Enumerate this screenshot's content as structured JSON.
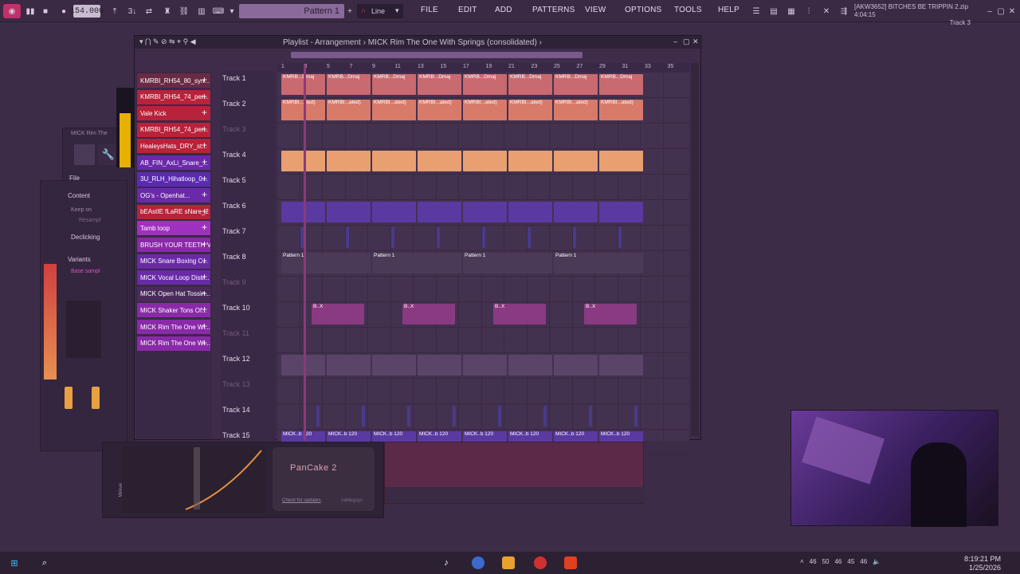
{
  "toolbar": {
    "bpm": "154.000",
    "pattern": "Pattern 1",
    "snap": "Line",
    "menus": [
      "FILE",
      "EDIT",
      "ADD",
      "PATTERNS",
      "VIEW",
      "OPTIONS",
      "TOOLS",
      "HELP"
    ],
    "hint_line1": "[AKW3652] BITCHES BE TRIPPIN 2.zip",
    "hint_line2": "4:04:15",
    "hint_line3": "Track 3"
  },
  "playlist": {
    "title": "Playlist - Arrangement › MICK Rim The One With Springs (consolidated) ›",
    "ruler": [
      "1",
      "3",
      "5",
      "7",
      "9",
      "11",
      "13",
      "15",
      "17",
      "19",
      "21",
      "23",
      "25",
      "27",
      "29",
      "31",
      "33",
      "35"
    ],
    "tracks": [
      "Track 1",
      "Track 2",
      "Track 3",
      "Track 4",
      "Track 5",
      "Track 6",
      "Track 7",
      "Track 8",
      "Track 9",
      "Track 10",
      "Track 11",
      "Track 12",
      "Track 13",
      "Track 14",
      "Track 15"
    ],
    "clip_labels": {
      "t1": "KMRB...Dmaj",
      "t2": "KMRBI...ated)",
      "t8": "Pattern 1",
      "t10": "B..X",
      "t15": "MICK..b 120"
    }
  },
  "channels": [
    {
      "label": "KMRBI_RH54_80_syn...",
      "color": "#6a2a44"
    },
    {
      "label": "KMRBI_RH54_74_per...",
      "color": "#b8223a"
    },
    {
      "label": "Vale Kick",
      "color": "#b8223a"
    },
    {
      "label": "KMRBI_RH54_74_per...",
      "color": "#b8223a"
    },
    {
      "label": "HealeysHats_DRY_st...",
      "color": "#b8223a"
    },
    {
      "label": "AB_FIN_AxLi_Snare_...",
      "color": "#6a2aa8"
    },
    {
      "label": "3U_RLH_Hihatloop_0...",
      "color": "#5a2ab0"
    },
    {
      "label": "OG's - Openhat...",
      "color": "#6a2aa8"
    },
    {
      "label": "bEAstIE fLaRE sNare_2",
      "color": "#b8223a"
    },
    {
      "label": "Tamb loop",
      "color": "#a030c0"
    },
    {
      "label": "BRUSH YOUR TEETH V...",
      "color": "#8a2aa8"
    },
    {
      "label": "MICK Snare Boxing C...",
      "color": "#6a2aa8"
    },
    {
      "label": "MICK Vocal Loop Distr...",
      "color": "#6a2aa8"
    },
    {
      "label": "MICK Open Hat Tossin...",
      "color": "#4a2a5a"
    },
    {
      "label": "MICK Shaker Tons Of...",
      "color": "#8a2aa8"
    },
    {
      "label": "MICK Rim The One Wi...",
      "color": "#8a2aa8"
    },
    {
      "label": "MICK Rim The One Wi...",
      "color": "#8a2aa8"
    }
  ],
  "side_panel": {
    "file_label": "File",
    "content_label": "Content",
    "keep_on": "Keep on",
    "resample": "Resampl",
    "declicking": "Declicking",
    "variants": "Variants",
    "base_sample": "Base sampl",
    "mick_label": "MICK Rim The"
  },
  "plugin": {
    "name": "PanCake 2",
    "check_updates": "Check for updates",
    "brand": "cableguys",
    "wave_label": "Wave"
  },
  "taskbar": {
    "time": "8:19:21 PM",
    "date": "1/25/2026",
    "tray_nums": [
      "46",
      "50",
      "46",
      "45",
      "46"
    ]
  }
}
